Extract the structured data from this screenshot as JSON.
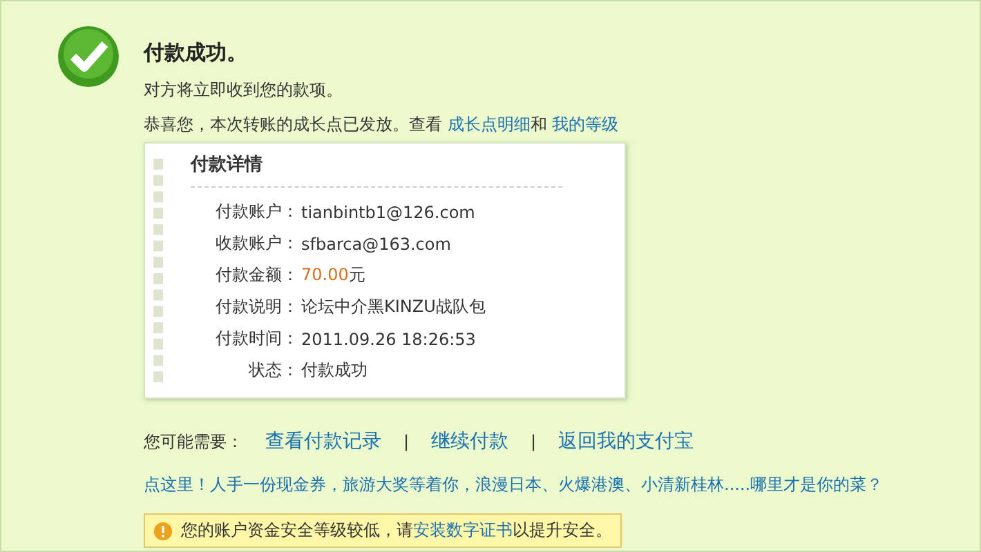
{
  "title": "付款成功。",
  "subtitle": "对方将立即收到您的款项。",
  "notice": [
    {
      "kind": "text",
      "text": "恭喜您，本次转账的成长点已发放。查看 "
    },
    {
      "kind": "link",
      "text": "成长点明细"
    },
    {
      "kind": "text",
      "text": "和 "
    },
    {
      "kind": "link",
      "text": "我的等级"
    }
  ],
  "details": {
    "title": "付款详情",
    "rows": [
      {
        "label": "付款账户：",
        "value": "tianbintb1@126.com"
      },
      {
        "label": "收款账户：",
        "value": "sfbarca@163.com"
      },
      {
        "label": "付款金额：",
        "value": "70.00",
        "suffix": "元",
        "kind": "amount"
      },
      {
        "label": "付款说明：",
        "value": "论坛中介黑KINZU战队包"
      },
      {
        "label": "付款时间：",
        "value": "2011.09.26 18:26:53"
      },
      {
        "label": "状态：",
        "value": "付款成功"
      }
    ]
  },
  "next": {
    "label": "您可能需要：",
    "links": [
      "查看付款记录",
      "继续付款",
      "返回我的支付宝"
    ],
    "separator": "|"
  },
  "promo": "点这里！人手一份现金券，旅游大奖等着你，浪漫日本、火爆港澳、小清新桂林.....哪里才是你的菜？",
  "warning": [
    {
      "kind": "text",
      "text": "您的账户资金安全等级较低，请"
    },
    {
      "kind": "link",
      "text": "安装数字证书"
    },
    {
      "kind": "text",
      "text": "以提升安全。"
    }
  ]
}
